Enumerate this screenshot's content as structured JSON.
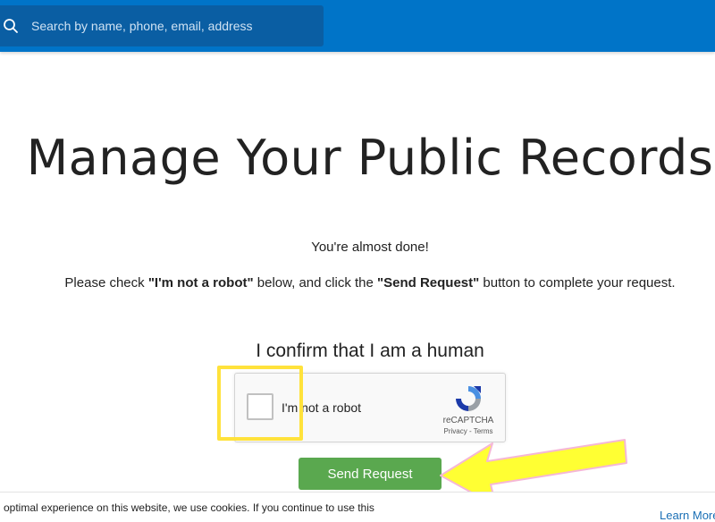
{
  "header": {
    "search_placeholder": "Search by name, phone, email, address",
    "bar_color": "#0074c8",
    "search_bg": "#0a5ea3"
  },
  "main": {
    "title": "Manage Your Public Records",
    "almost_done": "You're almost done!",
    "instructions": {
      "part1": "Please check ",
      "bold1": "\"I'm not a robot\"",
      "part2": " below, and click the ",
      "bold2": "\"Send Request\"",
      "part3": " button to complete your request."
    },
    "confirm_heading": "I confirm that I am a human"
  },
  "recaptcha": {
    "label": "I'm not a robot",
    "brand": "reCAPTCHA",
    "links": "Privacy - Terms",
    "icon": "recaptcha-logo-icon"
  },
  "send_button": {
    "label": "Send Request",
    "color": "#5aa84f"
  },
  "annotation": {
    "highlight_color": "#ffe23b",
    "arrow_color": "#ffff33"
  },
  "cookie_banner": {
    "text": "optimal experience on this website, we use cookies. If you continue to use this",
    "link": "Learn More"
  }
}
